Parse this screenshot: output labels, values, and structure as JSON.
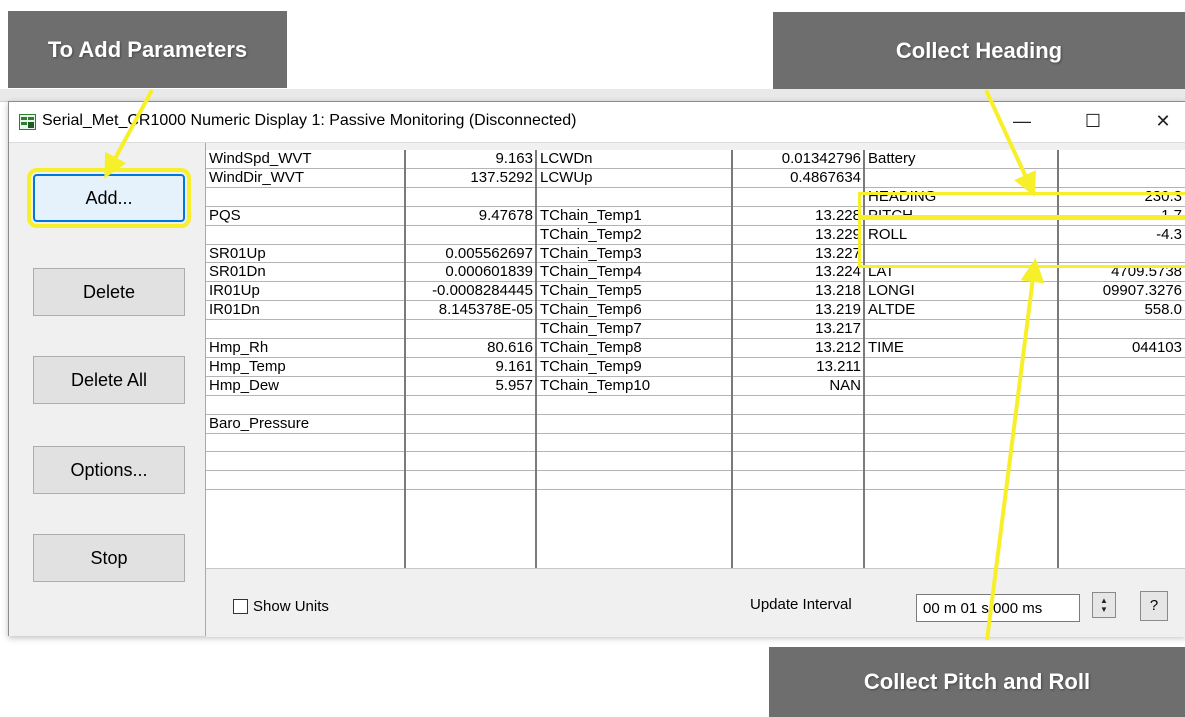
{
  "callouts": {
    "add": "To Add Parameters",
    "heading": "Collect Heading",
    "pitch_roll": "Collect Pitch and Roll"
  },
  "window": {
    "title": "Serial_Met_CR1000 Numeric Display 1: Passive Monitoring (Disconnected)",
    "controls": {
      "minimize": "—",
      "maximize": "☐",
      "close": "✕"
    }
  },
  "buttons": {
    "add": "Add...",
    "delete": "Delete",
    "delete_all": "Delete All",
    "options": "Options...",
    "stop": "Stop"
  },
  "grid": {
    "rows": [
      [
        [
          "WindSpd_WVT",
          "9.163"
        ],
        [
          "LCWDn",
          "0.01342796"
        ],
        [
          "Battery",
          ""
        ]
      ],
      [
        [
          "WindDir_WVT",
          "137.5292"
        ],
        [
          "LCWUp",
          "0.4867634"
        ],
        [
          "",
          ""
        ]
      ],
      [
        [
          "",
          ""
        ],
        [
          "",
          ""
        ],
        [
          "HEADING",
          "230.3"
        ]
      ],
      [
        [
          "PQS",
          "9.47678"
        ],
        [
          "TChain_Temp1",
          "13.228"
        ],
        [
          "PITCH",
          "1.7"
        ]
      ],
      [
        [
          "",
          ""
        ],
        [
          "TChain_Temp2",
          "13.229"
        ],
        [
          "ROLL",
          "-4.3"
        ]
      ],
      [
        [
          "SR01Up",
          "0.005562697"
        ],
        [
          "TChain_Temp3",
          "13.227"
        ],
        [
          "",
          ""
        ]
      ],
      [
        [
          "SR01Dn",
          "0.000601839"
        ],
        [
          "TChain_Temp4",
          "13.224"
        ],
        [
          "LAT",
          "4709.5738"
        ]
      ],
      [
        [
          "IR01Up",
          "-0.0008284445"
        ],
        [
          "TChain_Temp5",
          "13.218"
        ],
        [
          "LONGI",
          "09907.3276"
        ]
      ],
      [
        [
          "IR01Dn",
          "8.145378E-05"
        ],
        [
          "TChain_Temp6",
          "13.219"
        ],
        [
          "ALTDE",
          "558.0"
        ]
      ],
      [
        [
          "",
          ""
        ],
        [
          "TChain_Temp7",
          "13.217"
        ],
        [
          "",
          ""
        ]
      ],
      [
        [
          "Hmp_Rh",
          "80.616"
        ],
        [
          "TChain_Temp8",
          "13.212"
        ],
        [
          "TIME",
          "044103"
        ]
      ],
      [
        [
          "Hmp_Temp",
          "9.161"
        ],
        [
          "TChain_Temp9",
          "13.211"
        ],
        [
          "",
          ""
        ]
      ],
      [
        [
          "Hmp_Dew",
          "5.957"
        ],
        [
          "TChain_Temp10",
          "NAN"
        ],
        [
          "",
          ""
        ]
      ],
      [
        [
          "",
          ""
        ],
        [
          "",
          ""
        ],
        [
          "",
          ""
        ]
      ],
      [
        [
          "Baro_Pressure",
          ""
        ],
        [
          "",
          ""
        ],
        [
          "",
          ""
        ]
      ],
      [
        [
          "",
          ""
        ],
        [
          "",
          ""
        ],
        [
          "",
          ""
        ]
      ],
      [
        [
          "",
          ""
        ],
        [
          "",
          ""
        ],
        [
          "",
          ""
        ]
      ],
      [
        [
          "",
          ""
        ],
        [
          "",
          ""
        ],
        [
          "",
          ""
        ]
      ]
    ]
  },
  "bottom": {
    "show_units_label": "Show Units",
    "show_units_checked": false,
    "update_interval_label": "Update Interval",
    "update_interval_value": "00 m 01 s 000 ms",
    "help_label": "?"
  },
  "colors": {
    "callout_bg": "#6e6e6e",
    "highlight": "#f6ef2a",
    "focus_border": "#0078d7"
  },
  "icons": {
    "app": "numeric-display-app-icon",
    "spinner": "spin-up-down-icon"
  }
}
